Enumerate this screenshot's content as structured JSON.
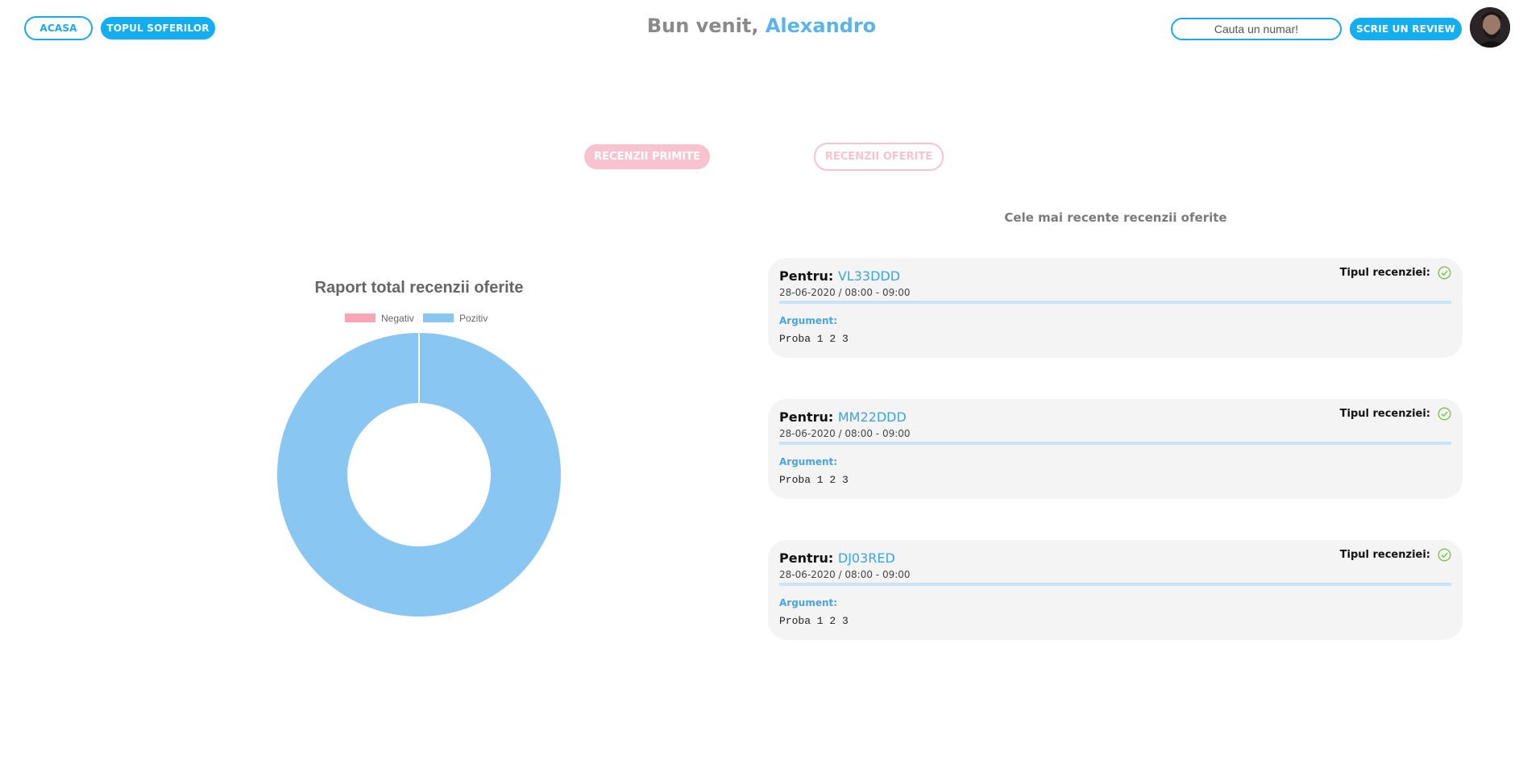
{
  "header": {
    "home_label": "ACASA",
    "top_drivers_label": "TOPUL SOFERILOR",
    "welcome_prefix": "Bun venit,",
    "user_name": "Alexandro",
    "search_placeholder": "Cauta un numar!",
    "write_review_label": "SCRIE UN REVIEW"
  },
  "tabs": {
    "received_label": "RECENZII PRIMITE",
    "offered_label": "RECENZII OFERITE"
  },
  "chart_data": {
    "type": "pie",
    "title": "Raport total recenzii oferite",
    "legend_position": "top",
    "categories": [
      "Negativ",
      "Pozitiv"
    ],
    "values": [
      0,
      3
    ],
    "colors": [
      "#f8a5b7",
      "#89c6f2"
    ]
  },
  "reviews": {
    "heading": "Cele mai recente recenzii oferite",
    "for_label": "Pentru:",
    "type_label": "Tipul recenziei:",
    "argument_label": "Argument:",
    "items": [
      {
        "plate": "VL33DDD",
        "date": "28-06-2020 / 08:00 - 09:00",
        "argument": "Proba 1 2 3",
        "type_icon": "check-circle-icon"
      },
      {
        "plate": "MM22DDD",
        "date": "28-06-2020 / 08:00 - 09:00",
        "argument": "Proba 1 2 3",
        "type_icon": "check-circle-icon"
      },
      {
        "plate": "DJ03RED",
        "date": "28-06-2020 / 08:00 - 09:00",
        "argument": "Proba 1 2 3",
        "type_icon": "check-circle-icon"
      }
    ]
  },
  "colors": {
    "accent": "#12aef0",
    "pink": "#f8c3cf",
    "check_green": "#7bc24a"
  }
}
